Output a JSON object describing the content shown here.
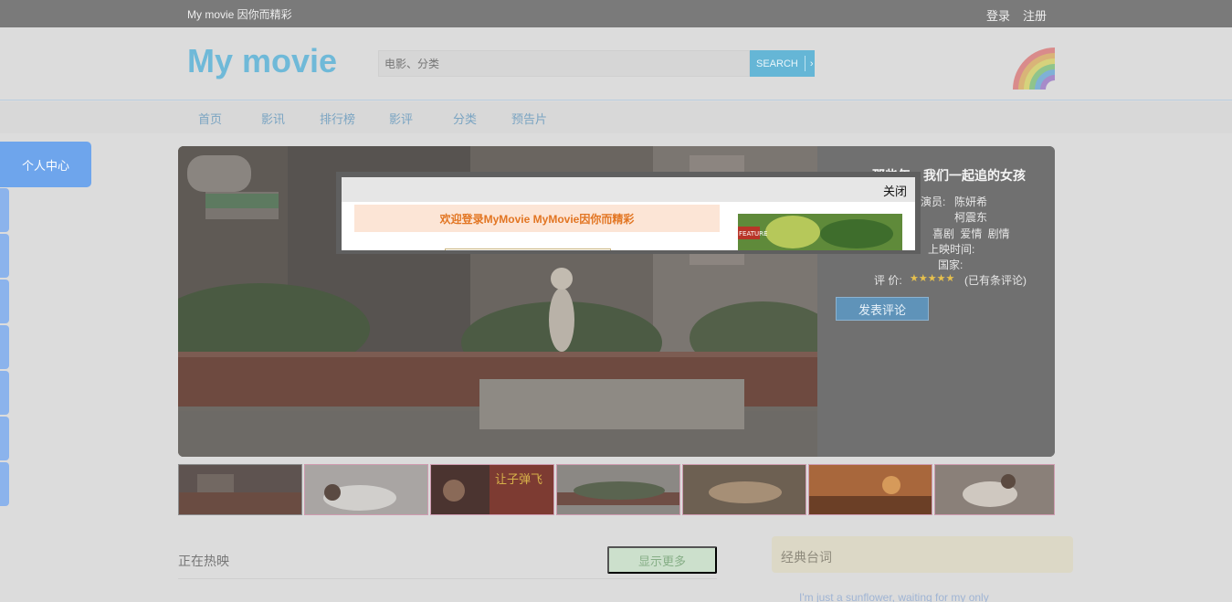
{
  "topbar": {
    "slogan": "My movie 因你而精彩",
    "login": "登录",
    "register": "注册"
  },
  "header": {
    "logo": "My movie",
    "search_placeholder": "电影、分类",
    "search_button": "SEARCH"
  },
  "nav": {
    "items": [
      "首页",
      "影讯",
      "排行榜",
      "影评",
      "分类",
      "预告片"
    ]
  },
  "sidebar": {
    "personal_center": "个人中心"
  },
  "featured": {
    "title": "那些年，我们一起追的女孩",
    "actors_label": "演员:",
    "actor_1": "陈妍希",
    "actor_2": "柯震东",
    "genres": "喜剧 爱情 剧情",
    "release_label": "上映时间:",
    "country_label": "国家:",
    "rating_label": "评 价:",
    "stars": "★★★★★",
    "comments": "(已有条评论)",
    "comment_button": "发表评论"
  },
  "sections": {
    "now_showing": "正在热映",
    "show_more": "显示更多",
    "classic_quotes": "经典台词",
    "quote_text": "I'm just a sunflower, waiting for my only"
  },
  "modal": {
    "close": "关闭",
    "welcome": "欢迎登录MyMovie MyMovie因你而精彩",
    "image_caption": "FEATURE"
  },
  "colors": {
    "accent": "#6fb9d8",
    "personal_center": "#6ea5ec",
    "welcome_text": "#e27522"
  }
}
